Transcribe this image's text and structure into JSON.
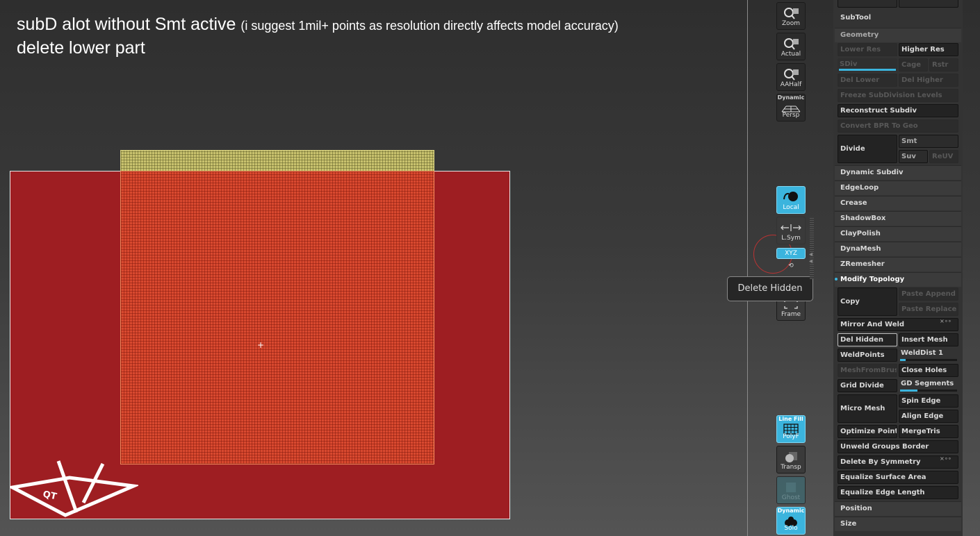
{
  "caption": {
    "line1_main": "subD alot without Smt active",
    "line1_note": "(i suggest 1mil+ points as resolution directly affects model accuracy)",
    "line2": "delete lower part"
  },
  "logo": {
    "text": "QT"
  },
  "crosshair": "+",
  "shelf": {
    "zoom": "Zoom",
    "actual": "Actual",
    "aahalf": "AAHalf",
    "dynamic_tag": "Dynamic",
    "persp": "Persp",
    "local": "Local",
    "lsym": "L.Sym",
    "xyz": "XYZ",
    "frame": "Frame",
    "line_fill_tag": "Line Fill",
    "polyf": "PolyF",
    "transp": "Transp",
    "ghost": "Ghost",
    "dynamic_tag2": "Dynamic",
    "solo": "Solo"
  },
  "tooltip": "Delete Hidden",
  "panel": {
    "subtool": "SubTool",
    "geometry": "Geometry",
    "lower_res": "Lower Res",
    "higher_res": "Higher Res",
    "sdiv": "SDiv",
    "cage": "Cage",
    "rstr": "Rstr",
    "del_lower": "Del Lower",
    "del_higher": "Del Higher",
    "freeze": "Freeze SubDivision Levels",
    "reconstruct": "Reconstruct Subdiv",
    "convert_bpr": "Convert BPR To Geo",
    "divide": "Divide",
    "smt": "Smt",
    "suv": "Suv",
    "reuv": "ReUV",
    "dynamic_subdiv": "Dynamic Subdiv",
    "edgeloop": "EdgeLoop",
    "crease": "Crease",
    "shadowbox": "ShadowBox",
    "claypolish": "ClayPolish",
    "dynamesh": "DynaMesh",
    "zremesher": "ZRemesher",
    "modify_topology": "Modify Topology",
    "copy": "Copy",
    "paste_append": "Paste Append",
    "paste_replace": "Paste Replace",
    "mirror_weld": "Mirror And Weld",
    "del_hidden": "Del Hidden",
    "insert_mesh": "Insert Mesh",
    "weldpoints": "WeldPoints",
    "welddist": "WeldDist 1",
    "meshfrombrush": "MeshFromBrush",
    "close_holes": "Close Holes",
    "grid_divide": "Grid Divide",
    "gd_segments": "GD Segments",
    "micro_mesh": "Micro Mesh",
    "spin_edge": "Spin Edge",
    "align_edge": "Align Edge",
    "optimize": "Optimize Points",
    "mergetris": "MergeTris",
    "unweld": "Unweld Groups Border",
    "delete_symmetry": "Delete By Symmetry",
    "equalize_surface": "Equalize Surface Area",
    "equalize_edge": "Equalize Edge Length",
    "position": "Position",
    "size": "Size"
  },
  "colors": {
    "accent": "#3bb4dd",
    "mesh_masked": "#9e1e22",
    "mesh_visible": "#d9492f",
    "mesh_hidden_strip": "#c9c26e"
  },
  "sliders": {
    "sdiv_level": 1.0,
    "welddist": 0.1,
    "gd_segments": 0.3
  }
}
